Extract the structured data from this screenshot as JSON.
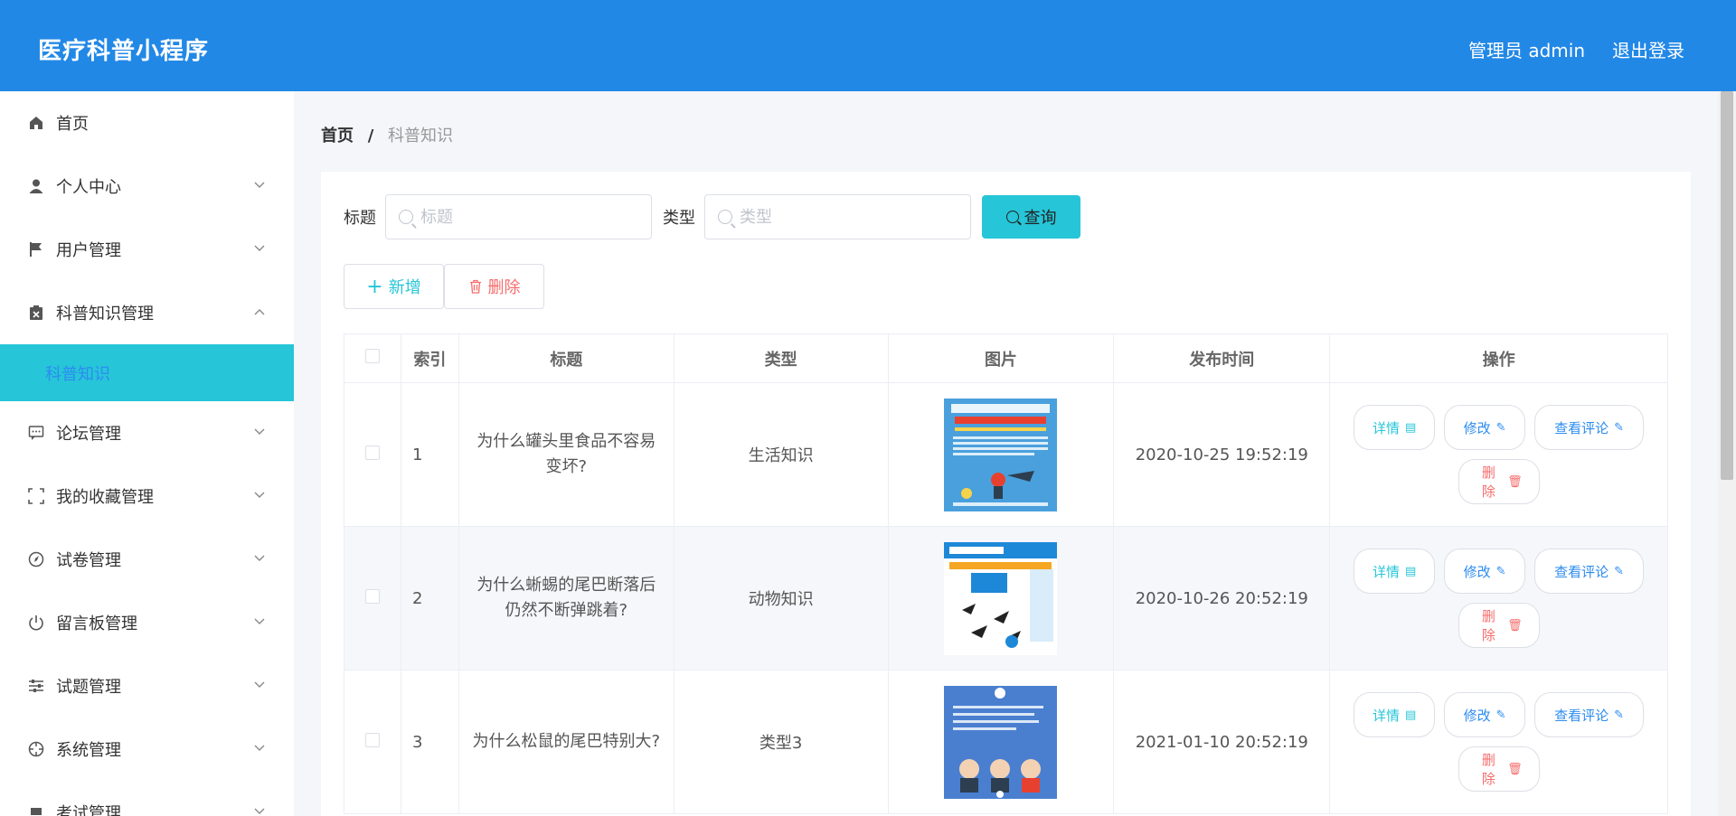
{
  "header": {
    "brand": "医疗科普小程序",
    "user": "管理员 admin",
    "logout": "退出登录"
  },
  "sidebar": {
    "items": [
      {
        "label": "首页",
        "icon": "home-icon"
      },
      {
        "label": "个人中心",
        "icon": "user-icon"
      },
      {
        "label": "用户管理",
        "icon": "flag-icon"
      },
      {
        "label": "科普知识管理",
        "icon": "clipboard-icon"
      },
      {
        "label": "论坛管理",
        "icon": "chat-icon"
      },
      {
        "label": "我的收藏管理",
        "icon": "frame-icon"
      },
      {
        "label": "试卷管理",
        "icon": "compass-icon"
      },
      {
        "label": "留言板管理",
        "icon": "power-icon"
      },
      {
        "label": "试题管理",
        "icon": "sliders-icon"
      },
      {
        "label": "系统管理",
        "icon": "target-icon"
      },
      {
        "label": "考试管理",
        "icon": "cap-icon"
      }
    ],
    "submenu": {
      "label": "科普知识"
    }
  },
  "breadcrumb": {
    "home": "首页",
    "separator": "/",
    "current": "科普知识"
  },
  "search": {
    "title_label": "标题",
    "title_placeholder": "标题",
    "type_label": "类型",
    "type_placeholder": "类型",
    "query_button": "查询"
  },
  "actions": {
    "add": "新增",
    "delete": "删除"
  },
  "table": {
    "columns": [
      "索引",
      "标题",
      "类型",
      "图片",
      "发布时间",
      "操作"
    ],
    "rows": [
      {
        "index": "1",
        "title": "为什么罐头里食品不容易变坏?",
        "type": "生活知识",
        "time": "2020-10-25 19:52:19"
      },
      {
        "index": "2",
        "title": "为什么蜥蜴的尾巴断落后仍然不断弹跳着?",
        "type": "动物知识",
        "time": "2020-10-26 20:52:19"
      },
      {
        "index": "3",
        "title": "为什么松鼠的尾巴特别大?",
        "type": "类型3",
        "time": "2021-01-10 20:52:19"
      }
    ],
    "row_ops": {
      "detail": "详情",
      "edit": "修改",
      "comment": "查看评论",
      "delete": "删除"
    }
  },
  "colors": {
    "header_bg": "#2288e6",
    "accent": "#26c5d8",
    "danger": "#f56c6c",
    "link": "#2d8cf0"
  }
}
